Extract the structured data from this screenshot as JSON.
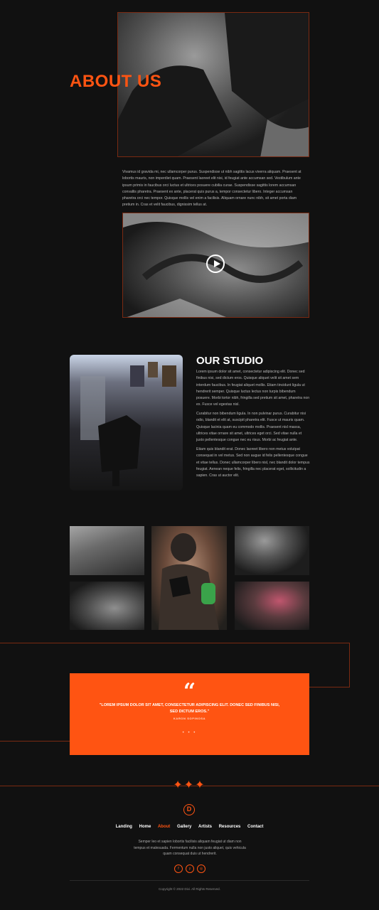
{
  "about": {
    "title": "ABOUT US",
    "body": "Vivamus id gravida mi, nec ullamcorper purus. Suspendisse ut nibh sagittis lacus viverra aliquam. Praesent at lobortis mauris, non imperdiet quam. Praesent laoreet elit nisi, id feugiat ante accumsan sed. Vestibulum ante ipsum primis in faucibus orci luctus et ultrices posuere cubilia curae. Suspendisse sagittis lorem accumsan convallis pharetra. Praesent ex ante, placerat quis purus a, tempor consectetur libero. Integer accumsan pharetra orci nec tempor. Quisque mollis vel enim a facilisis. Aliquam ornare nunc nibh, sit amet porta diam pretium in. Cras et velit faucibus, dignissim tellus at."
  },
  "studio": {
    "title": "OUR STUDIO",
    "p1": "Lorem ipsum dolor sit amet, consectetur adipiscing elit. Donec sed finibus nisi, sed dictum eros. Quisque aliquet velit sit amet sem interdum faucibus. In feugiat aliquet mollis. Etiam tincidunt ligula ut hendrerit semper. Quisque luctus lectus non turpis bibendum posuere. Morbi tortor nibh, fringilla sed pretium sit amet, pharetra non ex. Fusce vel egestas nisl.",
    "p2": "Curabitur non bibendum ligula. In non pulvinar purus. Curabitur nisi odio, blandit et elit at, suscipit pharetra elit. Fusce ut mauris quam. Quisque lacinia quam eu commodo mollis. Praesent nisl massa, ultrices vitae ornare sit amet, ultrices eget orci. Sed vitae nulla et justo pellentesque congue nec eu risus. Morbi ac feugiat ante.",
    "p3": "Etiam quis blandit erat. Donec laoreet libero non metus volutpat consequat in vel metus. Sed non augue id felis pellentesque congue et vitae tellus. Donec ullamcorper libero nisl, nec blandit dolor tempus feugiat. Aenean neque felis, fringilla nec placerat eget, sollicitudin a sapien. Cras ut auctor elit."
  },
  "testimonial": {
    "quote_mark": "“",
    "text": "\"LOREM IPSUM DOLOR SIT AMET, CONSECTETUR ADIPISCING ELIT. DONEC SED FINIBUS NISI, SED DICTUM EROS.\"",
    "author": "KARON SOPINOSA",
    "dots": "• • •"
  },
  "footer": {
    "stars": "✦✦✦",
    "logo": "D",
    "nav": [
      "Landing",
      "Home",
      "About",
      "Gallery",
      "Artists",
      "Resources",
      "Contact"
    ],
    "active_nav": "About",
    "text": "Semper leo et sapien lobortis facilisis aliquam feugiat ut diam non tempus et malesuada. Fermentum nulla non justo aliquet, quis vehicula quam consequat duis ut hendrerit.",
    "social": [
      "f",
      "y",
      "◎"
    ],
    "copyright": "Copyright © 2022 Divi. All Rights Reserved."
  },
  "colors": {
    "accent": "#ff5412",
    "background": "#111111"
  }
}
